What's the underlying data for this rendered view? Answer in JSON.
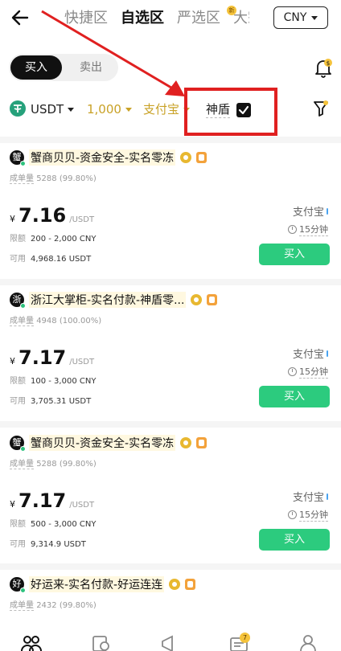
{
  "header": {
    "tabs": [
      "快捷区",
      "自选区",
      "严选区",
      "大宗"
    ],
    "active_tab_index": 1,
    "new_badge": "新",
    "currency": "CNY"
  },
  "trade_toggle": {
    "buy": "买入",
    "sell": "卖出",
    "active": "买入"
  },
  "filters": {
    "coin": "USDT",
    "amount": "1,000",
    "payment": "支付宝",
    "shield_label": "神盾",
    "shield_checked": true
  },
  "offers": [
    {
      "avatar": "蟹",
      "merchant": "蟹商贝贝-资金安全-实名零冻",
      "stats_label": "成单量",
      "stats_value": "5288 (99.80%)",
      "currency_symbol": "¥",
      "price": "7.16",
      "unit": "/USDT",
      "limit_label": "限额",
      "limit": "200 - 2,000 CNY",
      "available_label": "可用",
      "available": "4,968.16 USDT",
      "payment": "支付宝",
      "time": "15分钟",
      "action": "买入"
    },
    {
      "avatar": "浙",
      "merchant": "浙江大掌柜-实名付款-神盾零...",
      "stats_label": "成单量",
      "stats_value": "4948 (100.00%)",
      "currency_symbol": "¥",
      "price": "7.17",
      "unit": "/USDT",
      "limit_label": "限额",
      "limit": "100 - 3,000 CNY",
      "available_label": "可用",
      "available": "3,705.31 USDT",
      "payment": "支付宝",
      "time": "15分钟",
      "action": "买入"
    },
    {
      "avatar": "蟹",
      "merchant": "蟹商贝贝-资金安全-实名零冻",
      "stats_label": "成单量",
      "stats_value": "5288 (99.80%)",
      "currency_symbol": "¥",
      "price": "7.17",
      "unit": "/USDT",
      "limit_label": "限额",
      "limit": "500 - 3,000 CNY",
      "available_label": "可用",
      "available": "9,314.9 USDT",
      "payment": "支付宝",
      "time": "15分钟",
      "action": "买入"
    },
    {
      "avatar": "好",
      "merchant": "好运来-实名付款-好运连连",
      "stats_label": "成单量",
      "stats_value": "2432 (99.80%)"
    }
  ],
  "bottom_nav": {
    "orders_badge": "7"
  },
  "colors": {
    "accent_gold": "#c9a227",
    "buy_green": "#2ccb7e",
    "annotation_red": "#e02020"
  }
}
